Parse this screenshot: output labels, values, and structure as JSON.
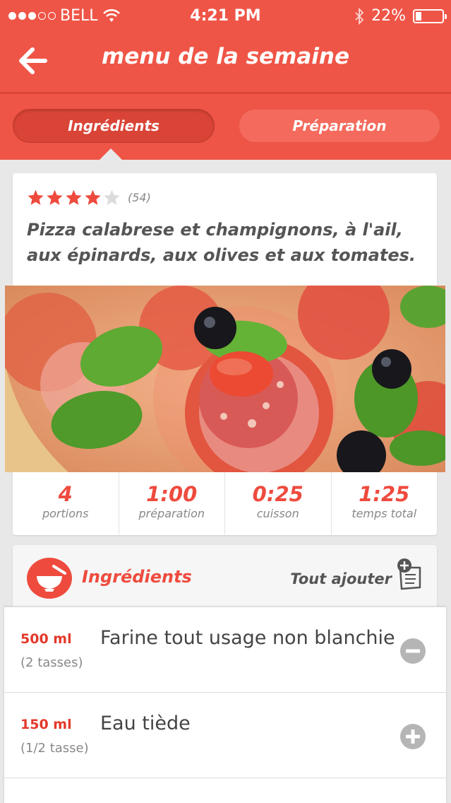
{
  "status_bar": {
    "carrier": "BELL",
    "time": "4:21 PM",
    "battery": "22%",
    "signal_filled": 3,
    "signal_total": 5,
    "battery_level": 0.22
  },
  "nav": {
    "title": "menu de la semaine",
    "back_icon": "arrow-left-icon"
  },
  "tabs": [
    {
      "label": "Ingrédients",
      "active": true
    },
    {
      "label": "Préparation",
      "active": false
    }
  ],
  "recipe": {
    "rating": 4,
    "rating_max": 5,
    "review_count": "(54)",
    "title": "Pizza calabrese et champignons, à l'ail, aux épinards, aux olives et aux tomates."
  },
  "stats": [
    {
      "value": "4",
      "label": "portions"
    },
    {
      "value": "1:00",
      "label": "préparation"
    },
    {
      "value": "0:25",
      "label": "cuisson"
    },
    {
      "value": "1:25",
      "label": "temps total"
    }
  ],
  "ingredients_section": {
    "title": "Ingrédients",
    "add_all": "Tout ajouter",
    "icon": "bowl-icon",
    "add_all_icon": "add-to-list-icon"
  },
  "ingredients": [
    {
      "qty": "500 ml",
      "alt": "(2 tasses)",
      "name": "Farine tout usage non blanchie",
      "action": "minus"
    },
    {
      "qty": "150 ml",
      "alt": "(1/2 tasse)",
      "name": "Eau tiède",
      "action": "plus"
    }
  ],
  "colors": {
    "brand": "#ef5547",
    "accent_text": "#ee4b3e",
    "background": "#e8e8e8"
  }
}
